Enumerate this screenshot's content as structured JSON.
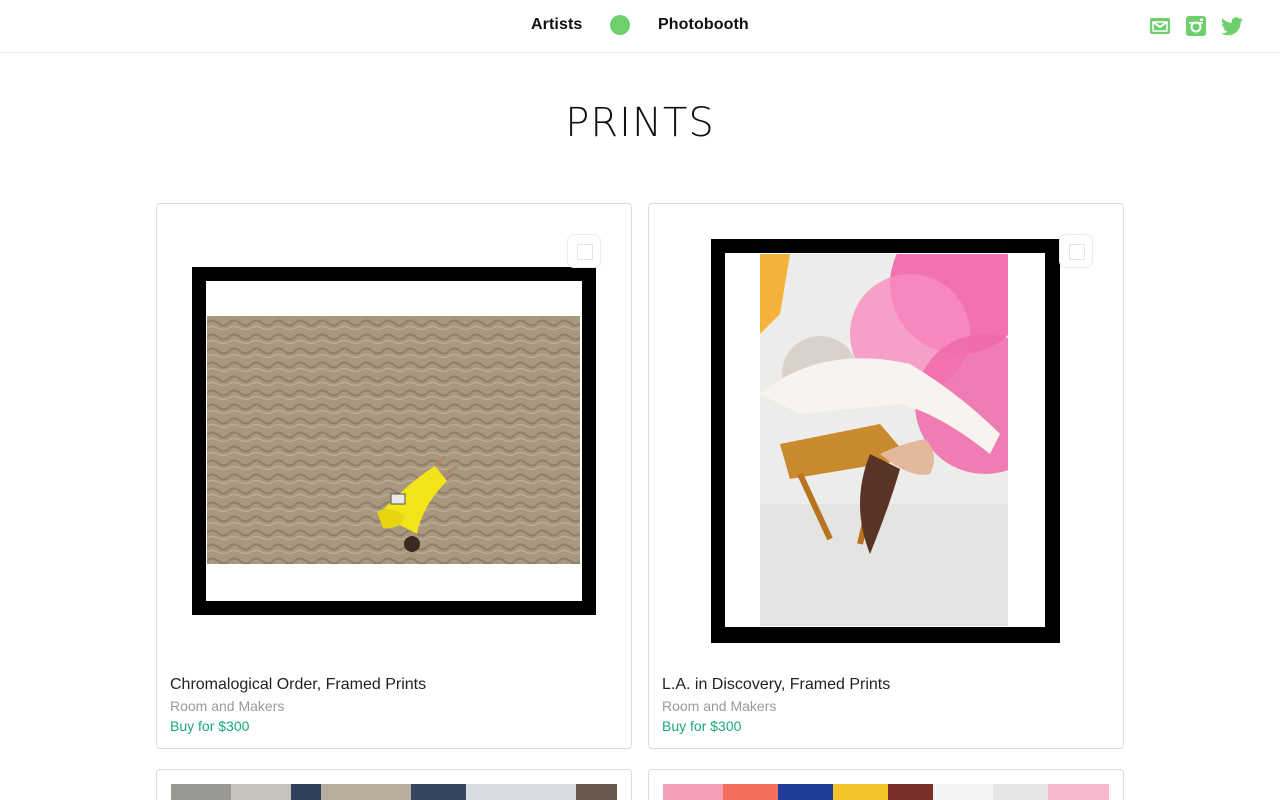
{
  "nav": {
    "artists": "Artists",
    "photobooth": "Photobooth",
    "accent": "#6dd06d"
  },
  "social": {
    "mail_icon": "mail-icon",
    "instagram_icon": "instagram-icon",
    "twitter_icon": "twitter-icon"
  },
  "page": {
    "title": "PRINTS"
  },
  "products": [
    {
      "title": "Chromalogical Order, Framed Prints",
      "artist": "Room and Makers",
      "buy": "Buy for $300",
      "image": "sand-beach-photo"
    },
    {
      "title": "L.A. in Discovery, Framed Prints",
      "artist": "Room and Makers",
      "buy": "Buy for $300",
      "image": "woman-on-chair-photo"
    }
  ],
  "colors": {
    "buy_link": "#19a974",
    "muted": "#9a9a9a"
  }
}
